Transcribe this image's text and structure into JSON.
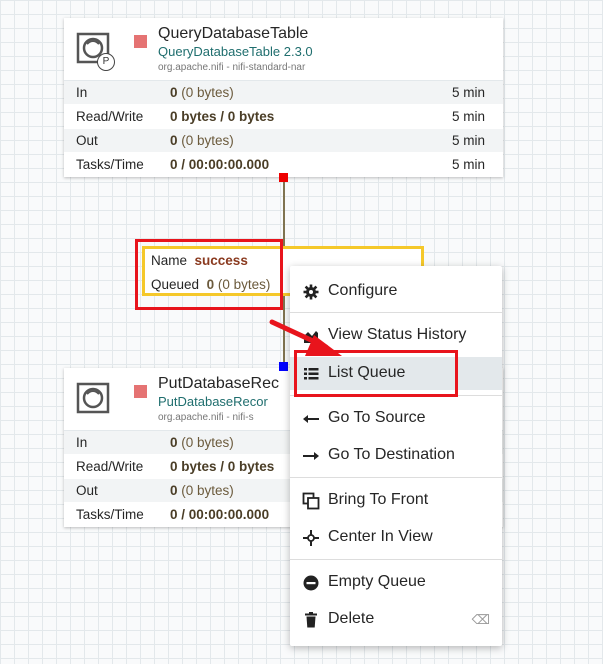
{
  "top_processor": {
    "name": "QueryDatabaseTable",
    "type": "QueryDatabaseTable 2.3.0",
    "bundle": "org.apache.nifi - nifi-standard-nar",
    "badge": "P",
    "stats": {
      "in_label": "In",
      "in_count": "0",
      "in_size": "(0 bytes)",
      "in_time": "5 min",
      "rw_label": "Read/Write",
      "rw_value": "0 bytes / 0 bytes",
      "rw_time": "5 min",
      "out_label": "Out",
      "out_count": "0",
      "out_size": "(0 bytes)",
      "out_time": "5 min",
      "tasks_label": "Tasks/Time",
      "tasks_value": "0 / 00:00:00.000",
      "tasks_time": "5 min"
    }
  },
  "bottom_processor": {
    "name": "PutDatabaseRec",
    "type": "PutDatabaseRecor",
    "bundle": "org.apache.nifi - nifi-s",
    "stats": {
      "in_label": "In",
      "in_count": "0",
      "in_size": "(0 bytes)",
      "rw_label": "Read/Write",
      "rw_value": "0 bytes / 0 bytes",
      "out_label": "Out",
      "out_count": "0",
      "out_size": "(0 bytes)",
      "tasks_label": "Tasks/Time",
      "tasks_value": "0 / 00:00:00.000"
    }
  },
  "connection": {
    "name_label": "Name",
    "name_value": "success",
    "queued_label": "Queued",
    "queued_count": "0",
    "queued_size": "(0 bytes)"
  },
  "context_menu": {
    "items": [
      {
        "label": "Configure",
        "icon": "gear-icon"
      },
      {
        "label": "View Status History",
        "icon": "chart-icon"
      },
      {
        "label": "List Queue",
        "icon": "list-icon"
      },
      {
        "label": "Go To Source",
        "icon": "arrow-left-icon"
      },
      {
        "label": "Go To Destination",
        "icon": "arrow-right-icon"
      },
      {
        "label": "Bring To Front",
        "icon": "bring-front-icon"
      },
      {
        "label": "Center In View",
        "icon": "crosshair-icon"
      },
      {
        "label": "Empty Queue",
        "icon": "minus-circle-icon"
      },
      {
        "label": "Delete",
        "icon": "trash-icon"
      }
    ]
  },
  "colors": {
    "highlight_red": "#e8141c",
    "connection_label_border": "#f5c82a",
    "stopped": "#e57373",
    "type_text": "#1f6e6e"
  }
}
